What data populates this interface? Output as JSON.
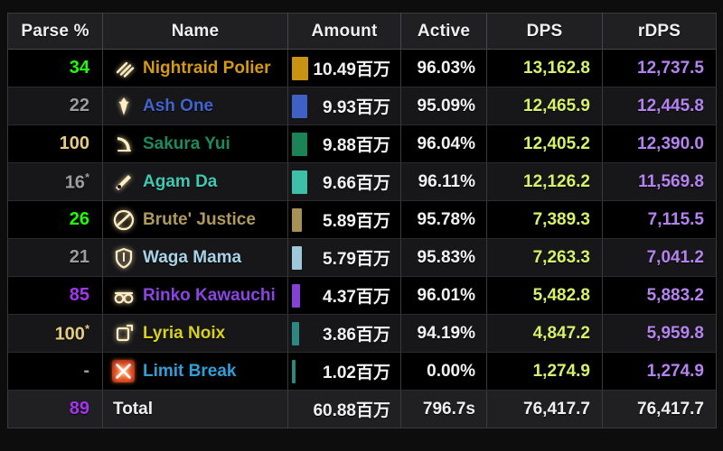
{
  "table": {
    "columns": [
      {
        "key": "parse",
        "label": "Parse %"
      },
      {
        "key": "name",
        "label": "Name"
      },
      {
        "key": "amount",
        "label": "Amount"
      },
      {
        "key": "active",
        "label": "Active"
      },
      {
        "key": "dps",
        "label": "DPS"
      },
      {
        "key": "rdps",
        "label": "rDPS"
      }
    ],
    "rows": [
      {
        "parse": "34",
        "parse_star": false,
        "parse_color": "#1eff00",
        "name": "Nightraid Polier",
        "name_color": "#d59a12",
        "icon": "monk-job-icon",
        "bar_color": "#d59a12",
        "bar_pct": 100,
        "amount": "10.49百万",
        "active": "96.03%",
        "dps": "13,162.8",
        "rdps": "12,737.5"
      },
      {
        "parse": "22",
        "parse_star": false,
        "parse_color": "#9d9d9d",
        "name": "Ash One",
        "name_color": "#4164cd",
        "icon": "dragoon-job-icon",
        "bar_color": "#4164cd",
        "bar_pct": 95,
        "amount": "9.93百万",
        "active": "95.09%",
        "dps": "12,465.9",
        "rdps": "12,445.8"
      },
      {
        "parse": "100",
        "parse_star": false,
        "parse_color": "#e5cc80",
        "name": "Sakura Yui",
        "name_color": "#1c8a5a",
        "icon": "bard-job-icon",
        "bar_color": "#1c8a5a",
        "bar_pct": 94
      },
      {
        "parse": "16",
        "parse_star": true,
        "parse_color": "#9d9d9d",
        "name": "Agam Da",
        "name_color": "#40c8b0",
        "icon": "machinist-job-icon",
        "bar_color": "#40c8b0",
        "bar_pct": 92
      },
      {
        "parse": "26",
        "parse_star": false,
        "parse_color": "#1eff00",
        "name": "Brute' Justice",
        "name_color": "#af9a5c",
        "icon": "ninja-job-icon",
        "bar_color": "#af9a5c",
        "bar_pct": 56
      },
      {
        "parse": "21",
        "parse_star": false,
        "parse_color": "#9d9d9d",
        "name": "Waga Mama",
        "name_color": "#a8d2e6",
        "icon": "paladin-job-icon",
        "bar_color": "#a8d2e6",
        "bar_pct": 55
      },
      {
        "parse": "85",
        "parse_star": false,
        "parse_color": "#a335ee",
        "name": "Rinko Kawauchi",
        "name_color": "#8c44e0",
        "icon": "astrologian-job-icon",
        "bar_color": "#8c44e0",
        "bar_pct": 42
      },
      {
        "parse": "100",
        "parse_star": true,
        "parse_color": "#e5cc80",
        "name": "Lyria Noix",
        "name_color": "#d8d11c",
        "icon": "summoner-job-icon",
        "bar_color": "#2d8f88",
        "bar_pct": 37
      },
      {
        "parse": "-",
        "parse_star": false,
        "parse_color": "#9d9d9d",
        "name": "Limit Break",
        "name_color": "#2f9fd8",
        "icon": "limit-break-icon",
        "bar_color": "#2d8f88",
        "bar_pct": 10
      }
    ],
    "row_values": [
      {
        "amount": "10.49百万",
        "active": "96.03%",
        "dps": "13,162.8",
        "rdps": "12,737.5"
      },
      {
        "amount": "9.93百万",
        "active": "95.09%",
        "dps": "12,465.9",
        "rdps": "12,445.8"
      },
      {
        "amount": "9.88百万",
        "active": "96.04%",
        "dps": "12,405.2",
        "rdps": "12,390.0"
      },
      {
        "amount": "9.66百万",
        "active": "96.11%",
        "dps": "12,126.2",
        "rdps": "11,569.8"
      },
      {
        "amount": "5.89百万",
        "active": "95.78%",
        "dps": "7,389.3",
        "rdps": "7,115.5"
      },
      {
        "amount": "5.79百万",
        "active": "95.83%",
        "dps": "7,263.3",
        "rdps": "7,041.2"
      },
      {
        "amount": "4.37百万",
        "active": "96.01%",
        "dps": "5,482.8",
        "rdps": "5,883.2"
      },
      {
        "amount": "3.86百万",
        "active": "94.19%",
        "dps": "4,847.2",
        "rdps": "5,959.8"
      },
      {
        "amount": "1.02百万",
        "active": "0.00%",
        "dps": "1,274.9",
        "rdps": "1,274.9"
      }
    ],
    "total": {
      "parse": "89",
      "parse_color": "#a335ee",
      "label": "Total",
      "amount": "60.88百万",
      "active": "796.7s",
      "dps": "76,417.7",
      "rdps": "76,417.7"
    }
  },
  "theme": {
    "header_bg": "#202022",
    "row_odd_bg": "#000000",
    "row_even_bg": "#17171a",
    "border": "#3a3a3c",
    "dps_color": "#d6f26a",
    "rdps_color": "#b583f0"
  }
}
